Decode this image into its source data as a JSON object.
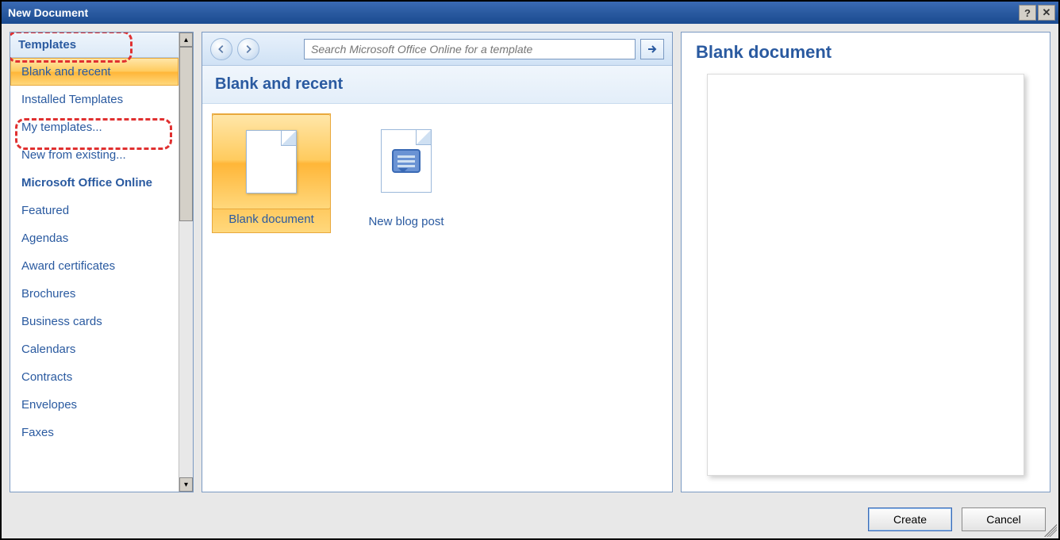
{
  "window": {
    "title": "New Document"
  },
  "sidebar": {
    "header": "Templates",
    "items": [
      {
        "label": "Blank and recent",
        "selected": true
      },
      {
        "label": "Installed Templates"
      },
      {
        "label": "My templates..."
      },
      {
        "label": "New from existing..."
      },
      {
        "label": "Microsoft Office Online",
        "bold": true
      },
      {
        "label": "Featured"
      },
      {
        "label": "Agendas"
      },
      {
        "label": "Award certificates"
      },
      {
        "label": "Brochures"
      },
      {
        "label": "Business cards"
      },
      {
        "label": "Calendars"
      },
      {
        "label": "Contracts"
      },
      {
        "label": "Envelopes"
      },
      {
        "label": "Faxes"
      }
    ]
  },
  "toolbar": {
    "search_placeholder": "Search Microsoft Office Online for a template"
  },
  "center": {
    "section_title": "Blank and recent",
    "tiles": [
      {
        "label": "Blank document",
        "selected": true,
        "kind": "blank"
      },
      {
        "label": "New blog post",
        "selected": false,
        "kind": "blog"
      }
    ]
  },
  "preview": {
    "title": "Blank document"
  },
  "footer": {
    "create": "Create",
    "cancel": "Cancel"
  }
}
